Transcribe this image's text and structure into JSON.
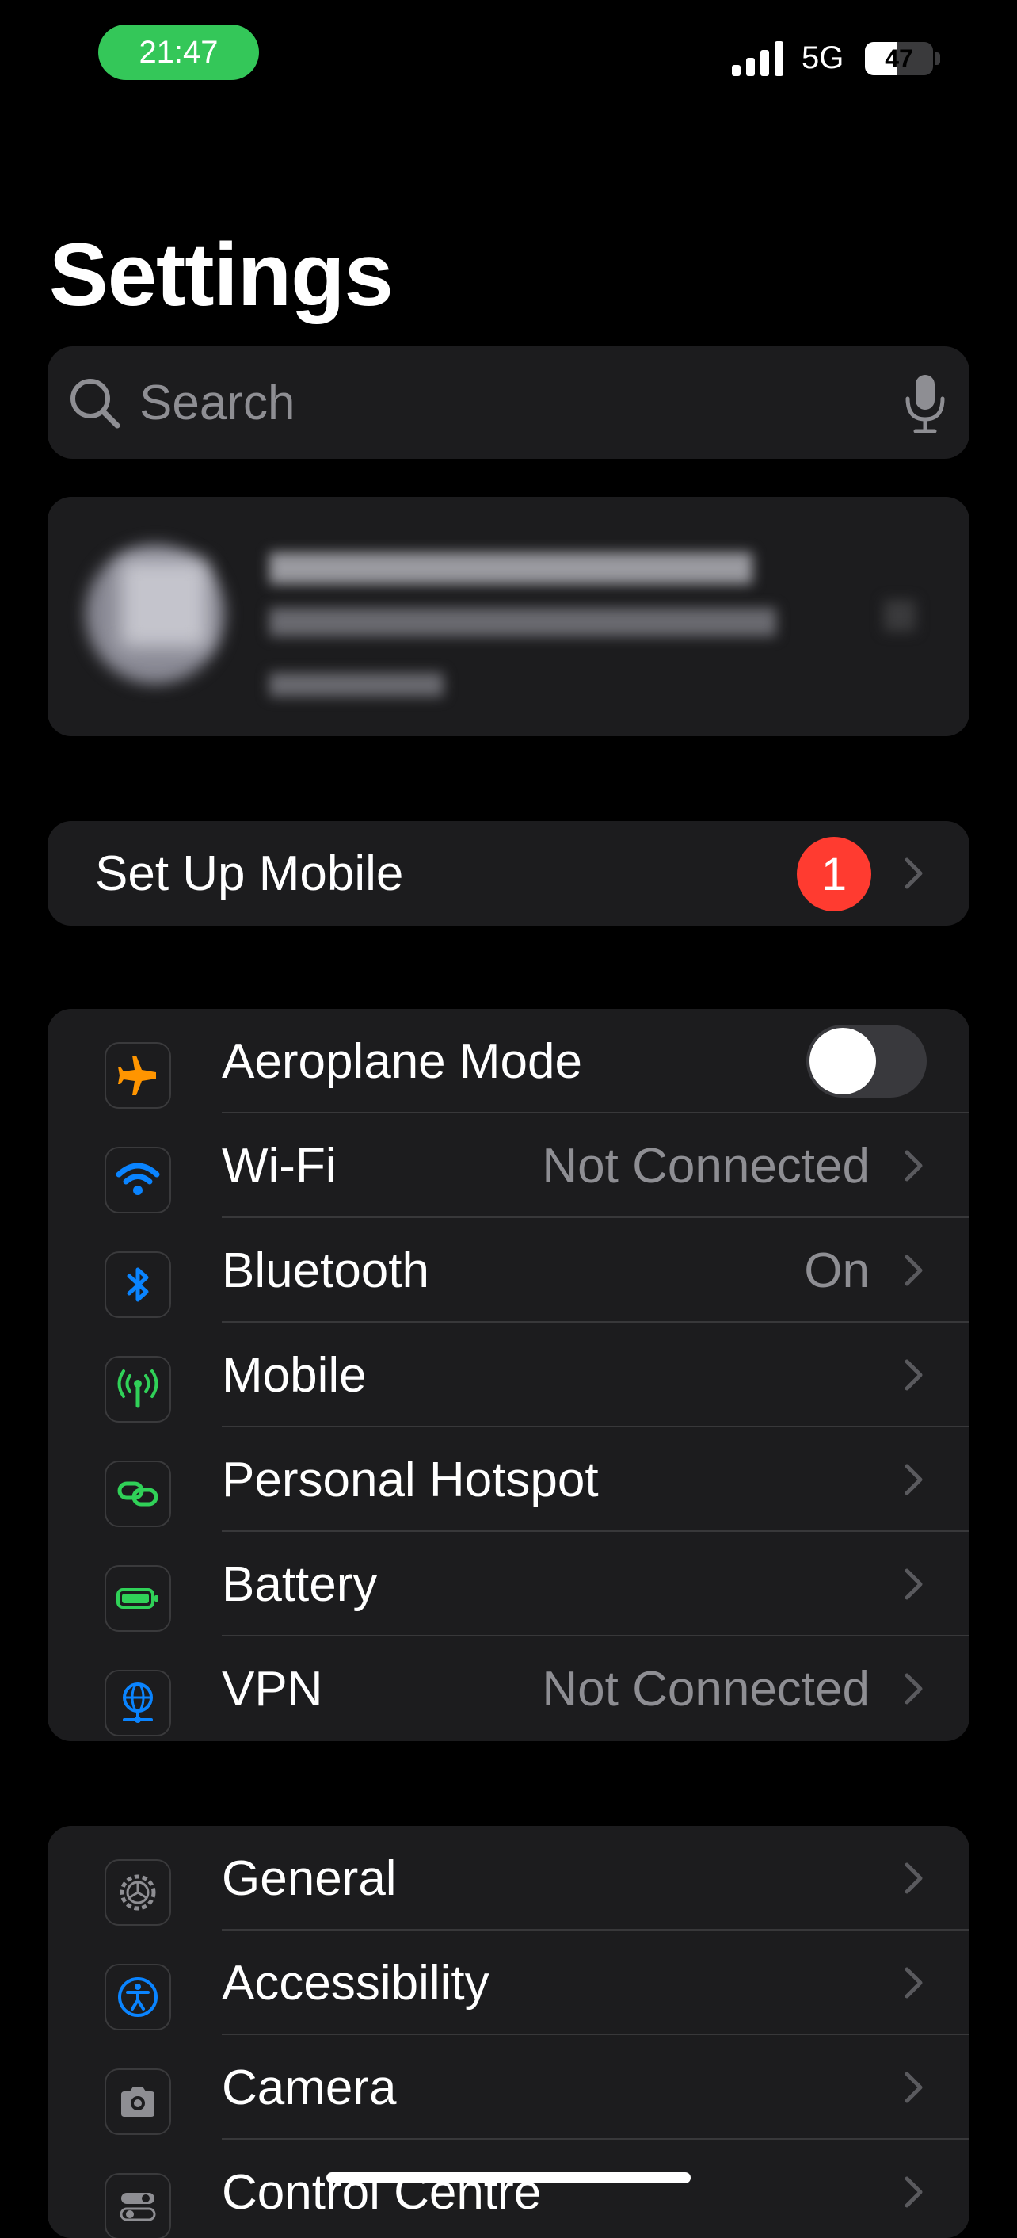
{
  "status_bar": {
    "time": "21:47",
    "network": "5G",
    "battery_level": "47",
    "battery_fraction": 0.47
  },
  "title": "Settings",
  "search": {
    "placeholder": "Search"
  },
  "setup_mobile": {
    "label": "Set Up Mobile",
    "badge": "1"
  },
  "connectivity": [
    {
      "label": "Aeroplane Mode",
      "icon": "airplane-icon",
      "icon_color": "#ff9500",
      "toggle": false
    },
    {
      "label": "Wi-Fi",
      "value": "Not Connected",
      "icon": "wifi-icon",
      "icon_color": "#0a84ff"
    },
    {
      "label": "Bluetooth",
      "value": "On",
      "icon": "bluetooth-icon",
      "icon_color": "#0a84ff"
    },
    {
      "label": "Mobile",
      "value": "",
      "icon": "antenna-icon",
      "icon_color": "#30d158"
    },
    {
      "label": "Personal Hotspot",
      "value": "",
      "icon": "hotspot-icon",
      "icon_color": "#30d158"
    },
    {
      "label": "Battery",
      "value": "",
      "icon": "battery-icon",
      "icon_color": "#30d158"
    },
    {
      "label": "VPN",
      "value": "Not Connected",
      "icon": "globe-icon",
      "icon_color": "#0a84ff"
    }
  ],
  "system": [
    {
      "label": "General",
      "icon": "gear-icon",
      "icon_color": "#8e8e93"
    },
    {
      "label": "Accessibility",
      "icon": "accessibility-icon",
      "icon_color": "#0a84ff"
    },
    {
      "label": "Camera",
      "icon": "camera-icon",
      "icon_color": "#8e8e93"
    },
    {
      "label": "Control Centre",
      "icon": "control-centre-icon",
      "icon_color": "#8e8e93"
    }
  ]
}
